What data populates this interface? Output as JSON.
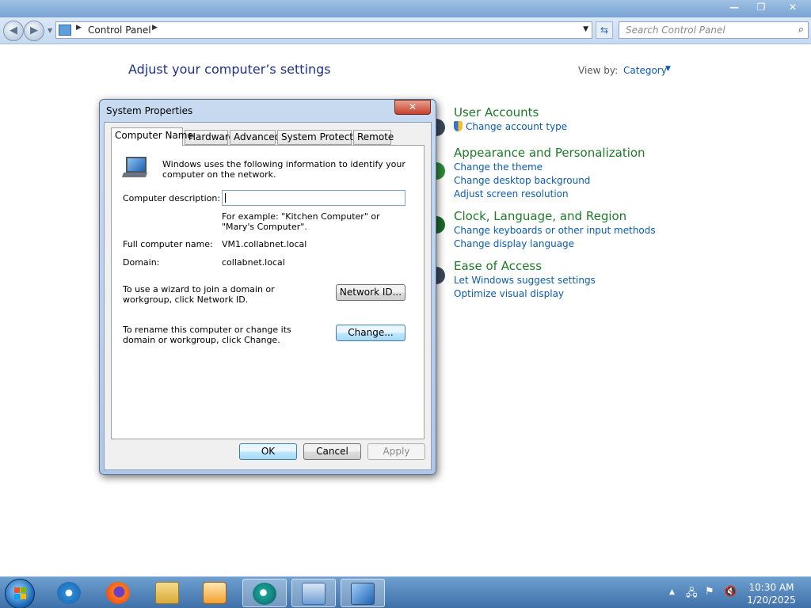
{
  "window": {
    "minimize_glyph": "—",
    "maximize_glyph": "❐",
    "close_glyph": "✕"
  },
  "navigation": {
    "back_glyph": "◀",
    "forward_glyph": "▶",
    "address_path": "Control Panel",
    "search_placeholder": "Search Control Panel"
  },
  "control_panel": {
    "title": "Adjust your computer’s settings",
    "view_by_label": "View by:",
    "view_by_value": "Category",
    "sections": [
      {
        "heading": "User Accounts",
        "links": [
          "Change account type"
        ]
      },
      {
        "heading": "Appearance and Personalization",
        "links": [
          "Change the theme",
          "Change desktop background",
          "Adjust screen resolution"
        ]
      },
      {
        "heading": "Clock, Language, and Region",
        "links": [
          "Change keyboards or other input methods",
          "Change display language"
        ]
      },
      {
        "heading": "Ease of Access",
        "links": [
          "Let Windows suggest settings",
          "Optimize visual display"
        ]
      }
    ]
  },
  "dialog": {
    "title": "System Properties",
    "close_glyph": "✕",
    "tabs": [
      "Computer Name",
      "Hardware",
      "Advanced",
      "System Protection",
      "Remote"
    ],
    "active_tab": "Computer Name",
    "intro_text": "Windows uses the following information to identify your computer on the network.",
    "description_label": "Computer description:",
    "description_value": "",
    "example_text": "For example: \"Kitchen Computer\" or \"Mary's Computer\".",
    "full_name_label": "Full computer name:",
    "full_name_value": "VM1.collabnet.local",
    "domain_label": "Domain:",
    "domain_value": "collabnet.local",
    "network_id_text": "To use a wizard to join a domain or workgroup, click Network ID.",
    "network_id_button": "Network ID...",
    "rename_text": "To rename this computer or change its domain or workgroup, click Change.",
    "change_button": "Change...",
    "ok_button": "OK",
    "cancel_button": "Cancel",
    "apply_button": "Apply"
  },
  "taskbar": {
    "pinned": [
      "internet-explorer-icon",
      "firefox-icon",
      "file-explorer-icon",
      "media-player-icon",
      "app-icon",
      "control-panel-icon",
      "system-properties-icon"
    ],
    "clock_time": "10:30 AM",
    "clock_date": "1/20/2025"
  }
}
